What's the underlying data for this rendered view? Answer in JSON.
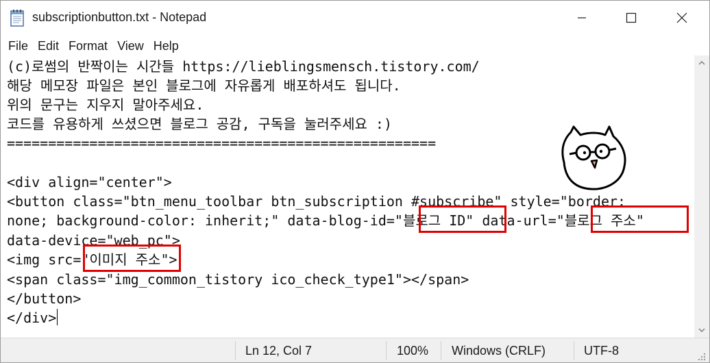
{
  "window": {
    "title": "subscriptionbutton.txt - Notepad",
    "app_icon": "notepad-icon",
    "controls": [
      "minimize-icon",
      "maximize-icon",
      "close-icon"
    ]
  },
  "menu": {
    "items": [
      "File",
      "Edit",
      "Format",
      "View",
      "Help"
    ]
  },
  "editor": {
    "lines": [
      "(c)로썸의 반짝이는 시간들 https://lieblingsmensch.tistory.com/",
      "해당 메모장 파일은 본인 블로그에 자유롭게 배포하셔도 됩니다.",
      "위의 문구는 지우지 말아주세요.",
      "코드를 유용하게 쓰셨으면 블로그 공감, 구독을 눌러주세요 :)",
      "====================================================",
      "",
      "<div align=\"center\">",
      "<button class=\"btn_menu_toolbar btn_subscription #subscribe\" style=\"border:",
      "none; background-color: inherit;\" data-blog-id=\"블로그 ID\" data-url=\"블로그 주소\"",
      "data-device=\"web_pc\">",
      "<img src=\"이미지 주소\">",
      "<span class=\"img_common_tistory ico_check_type1\"></span>",
      "</button>",
      "</div>"
    ],
    "decoration": "cat-doodle-icon",
    "highlight_color": "#e00000"
  },
  "status": {
    "position": "Ln 12, Col 7",
    "zoom": "100%",
    "line_ending": "Windows (CRLF)",
    "encoding": "UTF-8"
  }
}
